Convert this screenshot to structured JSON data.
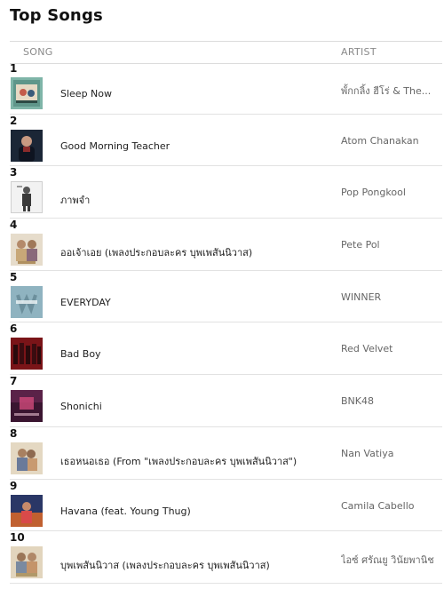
{
  "page": {
    "title": "Top Songs"
  },
  "table": {
    "headers": {
      "song": "SONG",
      "artist": "ARTIST"
    },
    "rows": [
      {
        "rank": "1",
        "song": "Sleep Now",
        "artist": "พั้กกลิ้ง ฮีโร่ & The...",
        "art_color": "#8fbfb0"
      },
      {
        "rank": "2",
        "song": "Good Morning Teacher",
        "artist": "Atom Chanakan",
        "art_color": "#1d2a3a"
      },
      {
        "rank": "3",
        "song": "ภาพจำ",
        "artist": "Pop Pongkool",
        "art_color": "#e9e9e9"
      },
      {
        "rank": "4",
        "song": "ออเจ้าเอย (เพลงประกอบละคร บุพเพสันนิวาส)",
        "artist": "Pete Pol",
        "art_color": "#cdb89a"
      },
      {
        "rank": "5",
        "song": "EVERYDAY",
        "artist": "WINNER",
        "art_color": "#8fb3c0"
      },
      {
        "rank": "6",
        "song": "Bad Boy",
        "artist": "Red Velvet",
        "art_color": "#8a1a1e"
      },
      {
        "rank": "7",
        "song": "Shonichi",
        "artist": "BNK48",
        "art_color": "#5a2240"
      },
      {
        "rank": "8",
        "song": "เธอหนอเธอ (From \"เพลงประกอบละคร บุพเพสันนิวาส\")",
        "artist": "Nan Vatiya",
        "art_color": "#c9b392"
      },
      {
        "rank": "9",
        "song": "Havana (feat. Young Thug)",
        "artist": "Camila Cabello",
        "art_color": "#2b3a6a"
      },
      {
        "rank": "10",
        "song": "บุพเพสันนิวาส (เพลงประกอบละคร บุพเพสันนิวาส)",
        "artist": "ไอซ์ ศรัณยู วินัยพานิช",
        "art_color": "#c6b08c"
      }
    ]
  }
}
